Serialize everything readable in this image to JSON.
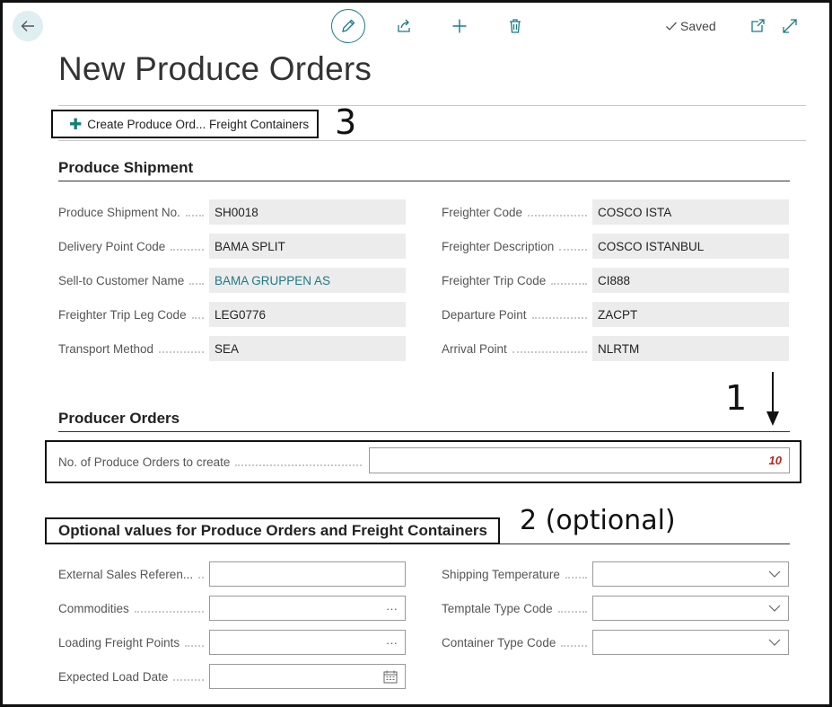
{
  "page": {
    "title": "New Produce Orders",
    "saved_label": "Saved"
  },
  "toolbar": {
    "back_icon": "arrow-left-icon",
    "edit_icon": "pencil-icon",
    "share_icon": "share-icon",
    "new_icon": "plus-icon",
    "delete_icon": "trash-icon",
    "popout_icon": "open-in-new-window-icon",
    "expand_icon": "expand-icon"
  },
  "actions": {
    "create_label": "Create Produce Ord... Freight Containers"
  },
  "callouts": {
    "one": "1",
    "two": "2 (optional)",
    "three": "3"
  },
  "produce_shipment": {
    "title": "Produce Shipment",
    "left": [
      {
        "label": "Produce Shipment No.",
        "value": "SH0018"
      },
      {
        "label": "Delivery Point Code",
        "value": "BAMA SPLIT"
      },
      {
        "label": "Sell-to Customer Name",
        "value": "BAMA GRUPPEN AS"
      },
      {
        "label": "Freighter Trip Leg Code",
        "value": "LEG0776"
      },
      {
        "label": "Transport Method",
        "value": "SEA"
      }
    ],
    "right": [
      {
        "label": "Freighter Code",
        "value": "COSCO ISTA"
      },
      {
        "label": "Freighter Description",
        "value": "COSCO ISTANBUL"
      },
      {
        "label": "Freighter Trip Code",
        "value": "CI888"
      },
      {
        "label": "Departure Point",
        "value": "ZACPT"
      },
      {
        "label": "Arrival Point",
        "value": "NLRTM"
      }
    ]
  },
  "producer_orders": {
    "title": "Producer Orders",
    "count_label": "No. of Produce Orders to create",
    "count_value": "10"
  },
  "optional": {
    "title": "Optional values for Produce Orders and Freight Containers",
    "left": [
      {
        "label": "External Sales Referen...",
        "value": ""
      },
      {
        "label": "Commodities",
        "value": "",
        "button": "···"
      },
      {
        "label": "Loading Freight Points",
        "value": "",
        "button": "···"
      },
      {
        "label": "Expected Load Date",
        "value": ""
      }
    ],
    "right": [
      {
        "label": "Shipping Temperature",
        "value": ""
      },
      {
        "label": "Temptale Type Code",
        "value": ""
      },
      {
        "label": "Container Type Code",
        "value": ""
      }
    ]
  },
  "colors": {
    "accent": "#1b7a87",
    "required_value": "#b3261e",
    "plus_green": "#138079"
  }
}
